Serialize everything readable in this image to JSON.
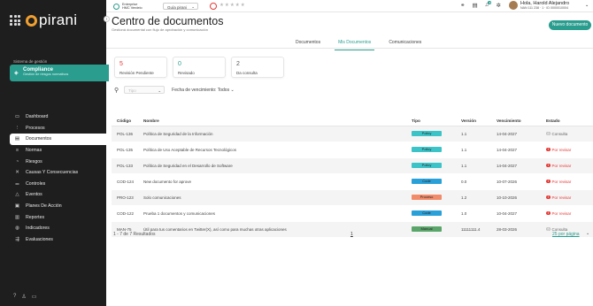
{
  "brand": {
    "name": "pirani"
  },
  "sidebar": {
    "system_label": "Sistema de gestión",
    "system_title": "Compliance",
    "system_sub": "Gestión de riesgos normativos",
    "items": [
      {
        "label": "Dashboard",
        "icon": "monitor-icon",
        "glyph": "▭"
      },
      {
        "label": "Procesos",
        "icon": "process-icon",
        "glyph": "⋮"
      },
      {
        "label": "Documentos",
        "icon": "document-icon",
        "glyph": "▤"
      },
      {
        "label": "Normas",
        "icon": "rules-icon",
        "glyph": "≡"
      },
      {
        "label": "Riesgos",
        "icon": "risk-icon",
        "glyph": "◔"
      },
      {
        "label": "Causas Y Consecuencias",
        "icon": "causes-icon",
        "glyph": "✕"
      },
      {
        "label": "Controles",
        "icon": "controls-icon",
        "glyph": "⚌"
      },
      {
        "label": "Eventos",
        "icon": "events-icon",
        "glyph": "△"
      },
      {
        "label": "Planes De Acción",
        "icon": "action-plan-icon",
        "glyph": "▣"
      },
      {
        "label": "Reportes",
        "icon": "reports-icon",
        "glyph": "▥"
      },
      {
        "label": "Indicadores",
        "icon": "indicators-icon",
        "glyph": "◍"
      },
      {
        "label": "Evaluaciones",
        "icon": "evaluations-icon",
        "glyph": "⇶"
      }
    ],
    "active_index": 2
  },
  "topbar": {
    "enterprise_line1": "Enterprise",
    "enterprise_line2": "HMC Verdelo",
    "guide_label": "Guía pirani",
    "stars": "★★★★★",
    "user_name": "Hola, Harold Alejandro",
    "user_detail": "NAN 111 238 · 1 · ID 0000010004"
  },
  "page": {
    "title": "Centro de documentos",
    "subtitle": "Gestioná documental con flujo de aprobación y comunicación",
    "new_button": "Nuevo documento",
    "tabs": [
      "Documentos",
      "Mis Documentos",
      "Comunicaciones"
    ],
    "active_tab": 1
  },
  "cards": [
    {
      "value": "5",
      "label": "Revisión Pendiente",
      "color": "#e53935"
    },
    {
      "value": "0",
      "label": "Revisado",
      "color": "#2a9d8f"
    },
    {
      "value": "2",
      "label": "Da consulta",
      "color": "#555555"
    }
  ],
  "filters": {
    "type_placeholder": "Tipo",
    "date_label": "Fecha de vencimiento: Todos"
  },
  "table": {
    "headers": [
      "Código",
      "Nombre",
      "Tipo",
      "Versión",
      "Vencimiento",
      "Estado"
    ],
    "rows": [
      {
        "code": "POL-136",
        "name": "Política de Seguridad de la Información",
        "type": "Policy",
        "type_color": "#3cc3c8",
        "version": "1.1",
        "due": "14-04-2027",
        "status": "Consulta",
        "status_kind": "consulta"
      },
      {
        "code": "POL-135",
        "name": "Política de Uso Aceptable de Recursos Tecnológicos",
        "type": "Policy",
        "type_color": "#3cc3c8",
        "version": "1.1",
        "due": "14-04-2027",
        "status": "Por revisar",
        "status_kind": "revisar"
      },
      {
        "code": "POL-133",
        "name": "Política de Seguridad en el Desarrollo de Software",
        "type": "Policy",
        "type_color": "#3cc3c8",
        "version": "1.1",
        "due": "14-04-2027",
        "status": "Por revisar",
        "status_kind": "revisar"
      },
      {
        "code": "COD-124",
        "name": "New documento for aprove",
        "type": "Code",
        "type_color": "#2aa0d8",
        "version": "0.0",
        "due": "10-07-2026",
        "status": "Por revisar",
        "status_kind": "revisar"
      },
      {
        "code": "PRO-123",
        "name": "Solo comunicaciones",
        "type": "Proceso",
        "type_color": "#f28b6a",
        "version": "1.2",
        "due": "10-10-2026",
        "status": "Por revisar",
        "status_kind": "revisar"
      },
      {
        "code": "COD-122",
        "name": "Prueba 1 documentos y comunicaciones",
        "type": "Code",
        "type_color": "#2aa0d8",
        "version": "1.0",
        "due": "10-04-2027",
        "status": "Por revisar",
        "status_kind": "revisar"
      },
      {
        "code": "MAN-75",
        "name": "Útil para tus comentarios en Twitter(X), así como para muchas otras aplicaciones",
        "type": "Manual",
        "type_color": "#5aa56a",
        "version": "11111111.4",
        "due": "28-03-2026",
        "status": "Consulta",
        "status_kind": "consulta"
      }
    ]
  },
  "footer": {
    "results": "1 - 7 de 7 Resultados",
    "page": "1",
    "per_page": "25 por página"
  },
  "colors": {
    "accent": "#2a9d8f",
    "danger": "#e53935",
    "sidebar": "#1e1e1e"
  }
}
